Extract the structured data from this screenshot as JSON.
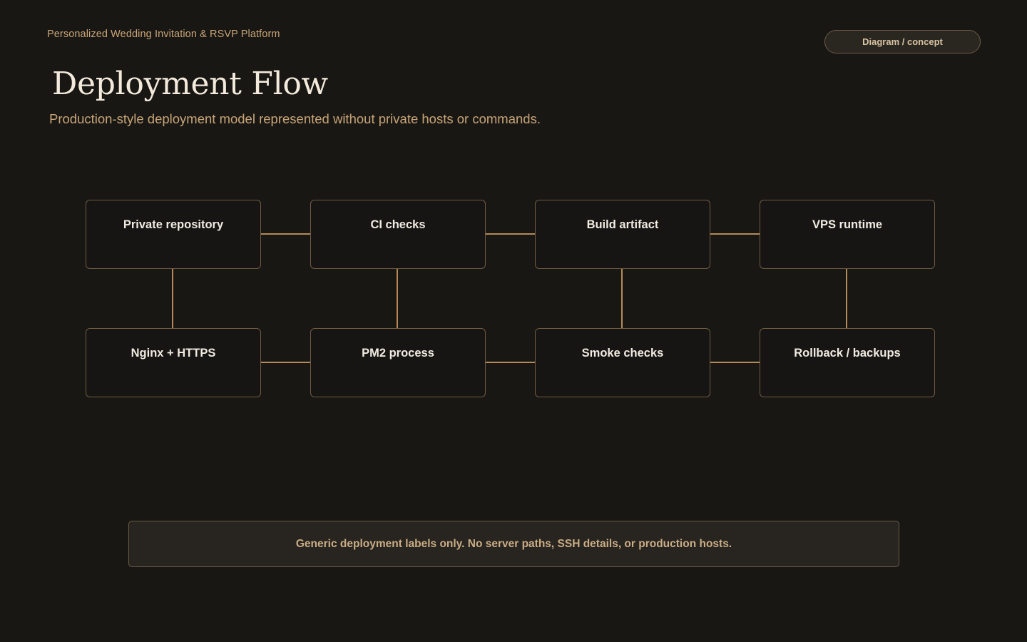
{
  "header": {
    "eyebrow": "Personalized Wedding Invitation & RSVP Platform",
    "badge": "Diagram / concept",
    "title": "Deployment Flow",
    "subtitle": "Production-style deployment model represented without private hosts or commands."
  },
  "diagram": {
    "nodes": [
      {
        "label": "Private repository"
      },
      {
        "label": "CI checks"
      },
      {
        "label": "Build artifact"
      },
      {
        "label": "VPS runtime"
      },
      {
        "label": "Nginx + HTTPS"
      },
      {
        "label": "PM2 process"
      },
      {
        "label": "Smoke checks"
      },
      {
        "label": "Rollback / backups"
      }
    ],
    "edges": [
      [
        "Private repository",
        "CI checks"
      ],
      [
        "CI checks",
        "Build artifact"
      ],
      [
        "Build artifact",
        "VPS runtime"
      ],
      [
        "Private repository",
        "Nginx + HTTPS"
      ],
      [
        "CI checks",
        "PM2 process"
      ],
      [
        "Build artifact",
        "Smoke checks"
      ],
      [
        "VPS runtime",
        "Rollback / backups"
      ],
      [
        "Nginx + HTTPS",
        "PM2 process"
      ],
      [
        "PM2 process",
        "Smoke checks"
      ],
      [
        "Smoke checks",
        "Rollback / backups"
      ]
    ]
  },
  "footer": {
    "note": "Generic deployment labels only. No server paths, SSH details, or production hosts."
  },
  "colors": {
    "background": "#181714",
    "accent": "#c9a577",
    "connector": "#b58a58",
    "node_border": "#6f5a40",
    "title": "#f3eadb"
  }
}
